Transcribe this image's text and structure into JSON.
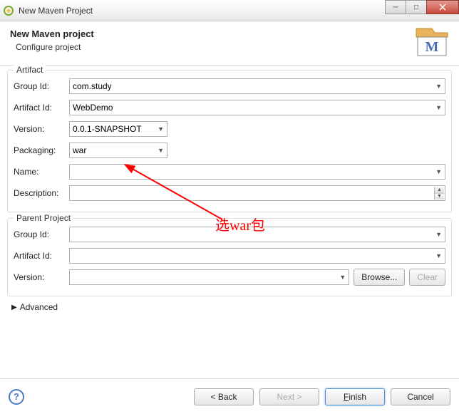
{
  "window": {
    "title": "New Maven Project"
  },
  "header": {
    "title": "New Maven project",
    "subtitle": "Configure project"
  },
  "artifact": {
    "legend": "Artifact",
    "groupId": {
      "label": "Group Id:",
      "value": "com.study"
    },
    "artifactId": {
      "label": "Artifact Id:",
      "value": "WebDemo"
    },
    "version": {
      "label": "Version:",
      "value": "0.0.1-SNAPSHOT"
    },
    "packaging": {
      "label": "Packaging:",
      "value": "war"
    },
    "name": {
      "label": "Name:",
      "value": ""
    },
    "description": {
      "label": "Description:",
      "value": ""
    }
  },
  "parent": {
    "legend": "Parent Project",
    "groupId": {
      "label": "Group Id:",
      "value": ""
    },
    "artifactId": {
      "label": "Artifact Id:",
      "value": ""
    },
    "version": {
      "label": "Version:",
      "value": ""
    },
    "browse": "Browse...",
    "clear": "Clear"
  },
  "advanced": {
    "label": "Advanced"
  },
  "footer": {
    "back": "< Back",
    "next": "Next >",
    "finish": "Finish",
    "cancel": "Cancel"
  },
  "annotation": {
    "text": "选war包"
  }
}
